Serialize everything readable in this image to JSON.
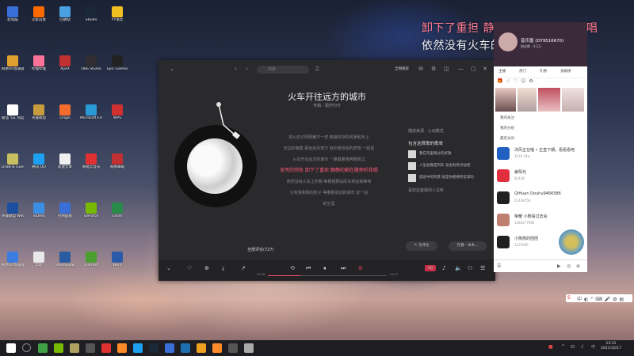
{
  "desktop_icons": [
    {
      "label": "此电脑",
      "color": "#3a6fd8"
    },
    {
      "label": "网易UU加速器 BATTLEGR...",
      "color": "#e0a030"
    },
    {
      "label": "极品飞车 热度",
      "color": "#ffffff"
    },
    {
      "label": "Draw & Guess",
      "color": "#c8c060"
    },
    {
      "label": "英雄联盟 WeGame",
      "color": "#1d4fa0"
    },
    {
      "label": "网易UU加速器",
      "color": "#3a7ce0"
    },
    {
      "label": "火影忍者",
      "color": "#ff6a00"
    },
    {
      "label": "哔哩哔哩",
      "color": "#fb7299"
    },
    {
      "label": "英雄联盟",
      "color": "#c89b3c"
    },
    {
      "label": "腾讯 QQ",
      "color": "#1ea0f0"
    },
    {
      "label": "ToDesk",
      "color": "#3a8ee6"
    },
    {
      "label": "帮助",
      "color": "#e8e8e8"
    },
    {
      "label": "回收站",
      "color": "#4aa0e0"
    },
    {
      "label": "ApeX",
      "color": "#c03030"
    },
    {
      "label": "Origin",
      "color": "#f56c2d"
    },
    {
      "label": "新建文本",
      "color": "#f0f0f0"
    },
    {
      "label": "控制面板",
      "color": "#3a6fd8"
    },
    {
      "label": "TeamSpeak",
      "color": "#2a5aa0"
    },
    {
      "label": "Steam",
      "color": "#1b2838"
    },
    {
      "label": "OBS Studio",
      "color": "#302e31"
    },
    {
      "label": "Microsoft Edge",
      "color": "#2a9ad6"
    },
    {
      "label": "网易云音乐",
      "color": "#e03030"
    },
    {
      "label": "GeForce",
      "color": "#76b900"
    },
    {
      "label": "uTorrent",
      "color": "#4a9f30"
    },
    {
      "label": "YY语音",
      "color": "#f0c020"
    },
    {
      "label": "Epic Games",
      "color": "#222222"
    },
    {
      "label": "WPS",
      "color": "#d03030"
    },
    {
      "label": "网易邮箱",
      "color": "#c03030"
    },
    {
      "label": "Excel",
      "color": "#2a8a4a"
    },
    {
      "label": "Word",
      "color": "#2a5aa8"
    }
  ],
  "overlay": {
    "line1": "卸下了重担 静静的躺在路旁听我唱",
    "line2": "依然没有火车的声音 来我真的"
  },
  "music": {
    "search_placeholder": "搜索",
    "top_right": "全网搜索",
    "title": "火车开往远方的城市",
    "artist": "专辑 · 顾作归兮",
    "lyrics": [
      "如火的夕阳照耀不一样 像被封存的风景和天上",
      "天边的晚霞 那远处的地方 有你我曾经的梦想 一起看",
      "火车开往远方的城市 一路载着我奔跑而过",
      "发亮的铁轨 卸下了重担 静静的躺在路旁听我唱",
      "依然没有火车上的我 等着我那站的车到站我等待",
      "只有我和我的影子 等着那遥远的城市 这一站",
      "的生涯"
    ],
    "active_lyric_index": 3,
    "side_head": "播放来源 · 心动模式",
    "side_head2": "包含这首歌的歌单",
    "side_items": [
      "我在风里唱过的好歌",
      "人生就像是列车 总会有终点站吧",
      "旅途中的风景 就是你想要的答案吗"
    ],
    "side_more": "喜欢这首歌的人在听",
    "comments": "全部评论(727)",
    "write_comment": "写评论",
    "listen_label": "在看 · 木木...",
    "time_current": "00:58",
    "time_total": "03:37",
    "progress": 0.27
  },
  "live": {
    "name": "音乐屋  (DY9516670)",
    "subtitle": "粉丝数 · 4.2万",
    "tabs": [
      "主播",
      "热门",
      "礼物",
      "贡献榜"
    ],
    "section1": "我的关注",
    "section2": "我的分组",
    "section3": "最近访问",
    "users": [
      {
        "name": "沐风正在唱 • 正直下期，看看看吧",
        "stat": "2676.24w",
        "color": "#2060c0"
      },
      {
        "name": "姜阳光",
        "stat": "82438",
        "color": "#e03040"
      },
      {
        "name": "QiHuan  Douhu9466586",
        "stat": "22438558",
        "color": "#202020"
      },
      {
        "name": "荣耀 小熊看过去会",
        "stat": "1483277986",
        "color": "#c08070"
      },
      {
        "name": "小熊熊的团团",
        "stat": "1237666",
        "color": "#202020"
      }
    ]
  },
  "clock": {
    "time": "13:31",
    "date": "2021/10/17"
  }
}
